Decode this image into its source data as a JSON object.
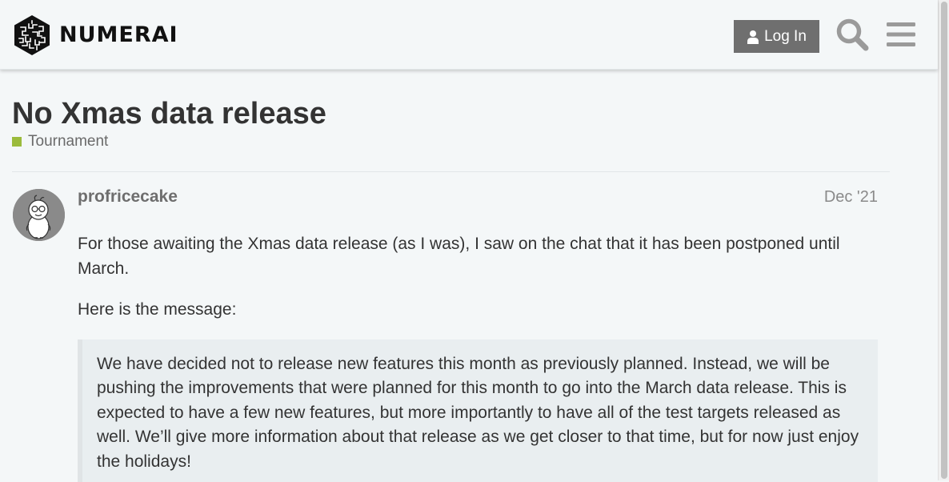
{
  "header": {
    "logo_text": "NUMERAI",
    "login_label": "Log In"
  },
  "topic": {
    "title": "No Xmas data release",
    "category": "Tournament",
    "category_color": "#9bbb3c"
  },
  "post": {
    "username": "profricecake",
    "date": "Dec '21",
    "paragraphs": [
      "For those awaiting the Xmas data release (as I was), I saw on the chat that it has been postponed until March.",
      "Here is the message:"
    ],
    "quote": "We have decided not to release new features this month as previously planned. Instead, we will be pushing the improvements that were planned for this month to go into the March data release. This is expected to have a few new features, but more importantly to have all of the test targets released as well. We’ll give more information about that release as we get closer to that time, but for now just enjoy the holidays!"
  },
  "icons": {
    "logo": "numerai-logo-icon",
    "user": "user-icon",
    "search": "search-icon",
    "menu": "hamburger-menu-icon"
  },
  "colors": {
    "login_button": "#6f6f6f",
    "icon_gray": "#9a9a9a",
    "background": "#f4f7f8",
    "quote_background": "#e9eef0"
  }
}
